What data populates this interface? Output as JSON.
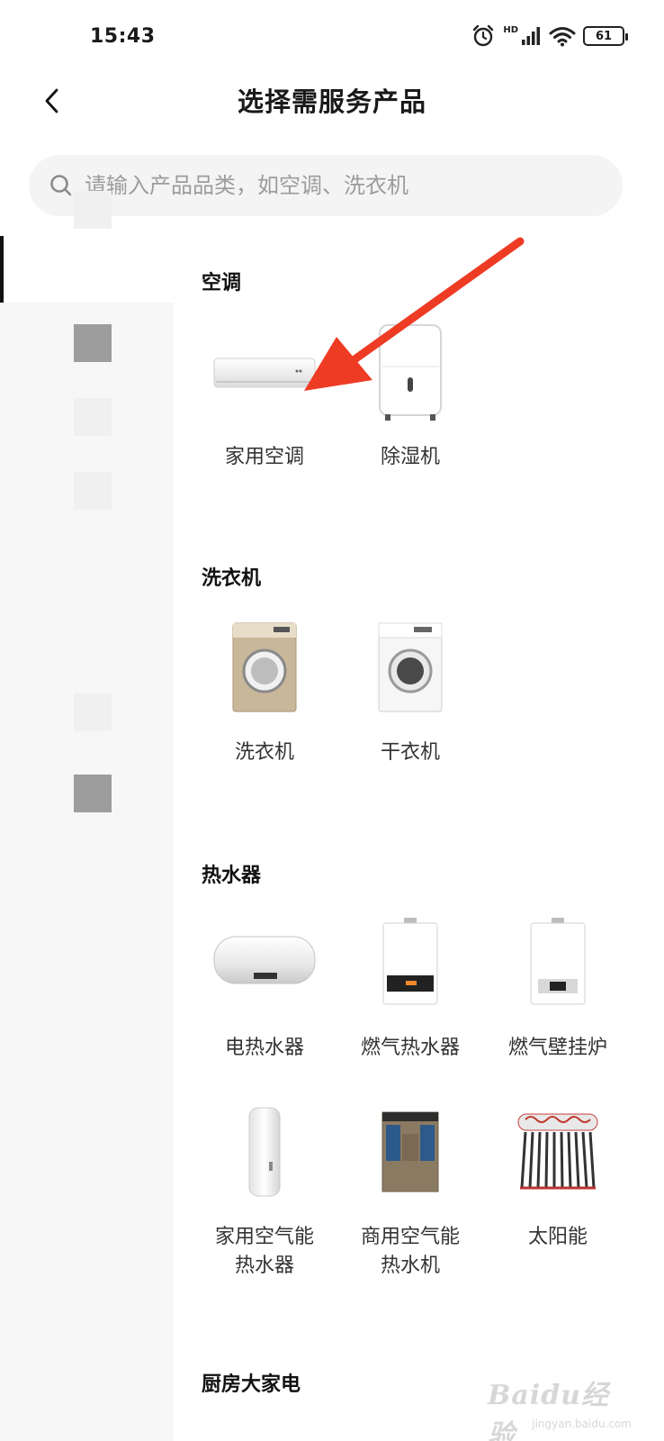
{
  "status": {
    "time": "15:43",
    "battery": "61",
    "network": "HD"
  },
  "header": {
    "title": "选择需服务产品"
  },
  "search": {
    "placeholder": "请输入产品品类，如空调、洗衣机"
  },
  "sections": [
    {
      "title": "空调",
      "products": [
        {
          "name": "家用空调"
        },
        {
          "name": "除湿机"
        }
      ]
    },
    {
      "title": "洗衣机",
      "products": [
        {
          "name": "洗衣机"
        },
        {
          "name": "干衣机"
        }
      ]
    },
    {
      "title": "热水器",
      "products": [
        {
          "name": "电热水器"
        },
        {
          "name": "燃气热水器"
        },
        {
          "name": "燃气壁挂炉"
        },
        {
          "name": "家用空气能\n热水器"
        },
        {
          "name": "商用空气能\n热水机"
        },
        {
          "name": "太阳能"
        }
      ]
    },
    {
      "title": "厨房大家电"
    }
  ],
  "watermark": {
    "brand": "Baidu经验",
    "url": "jingyan.baidu.com"
  },
  "colors": {
    "annotation_arrow": "#ee3b24",
    "sidebar_bg": "#f7f7f7",
    "search_bg": "#f4f4f4"
  }
}
